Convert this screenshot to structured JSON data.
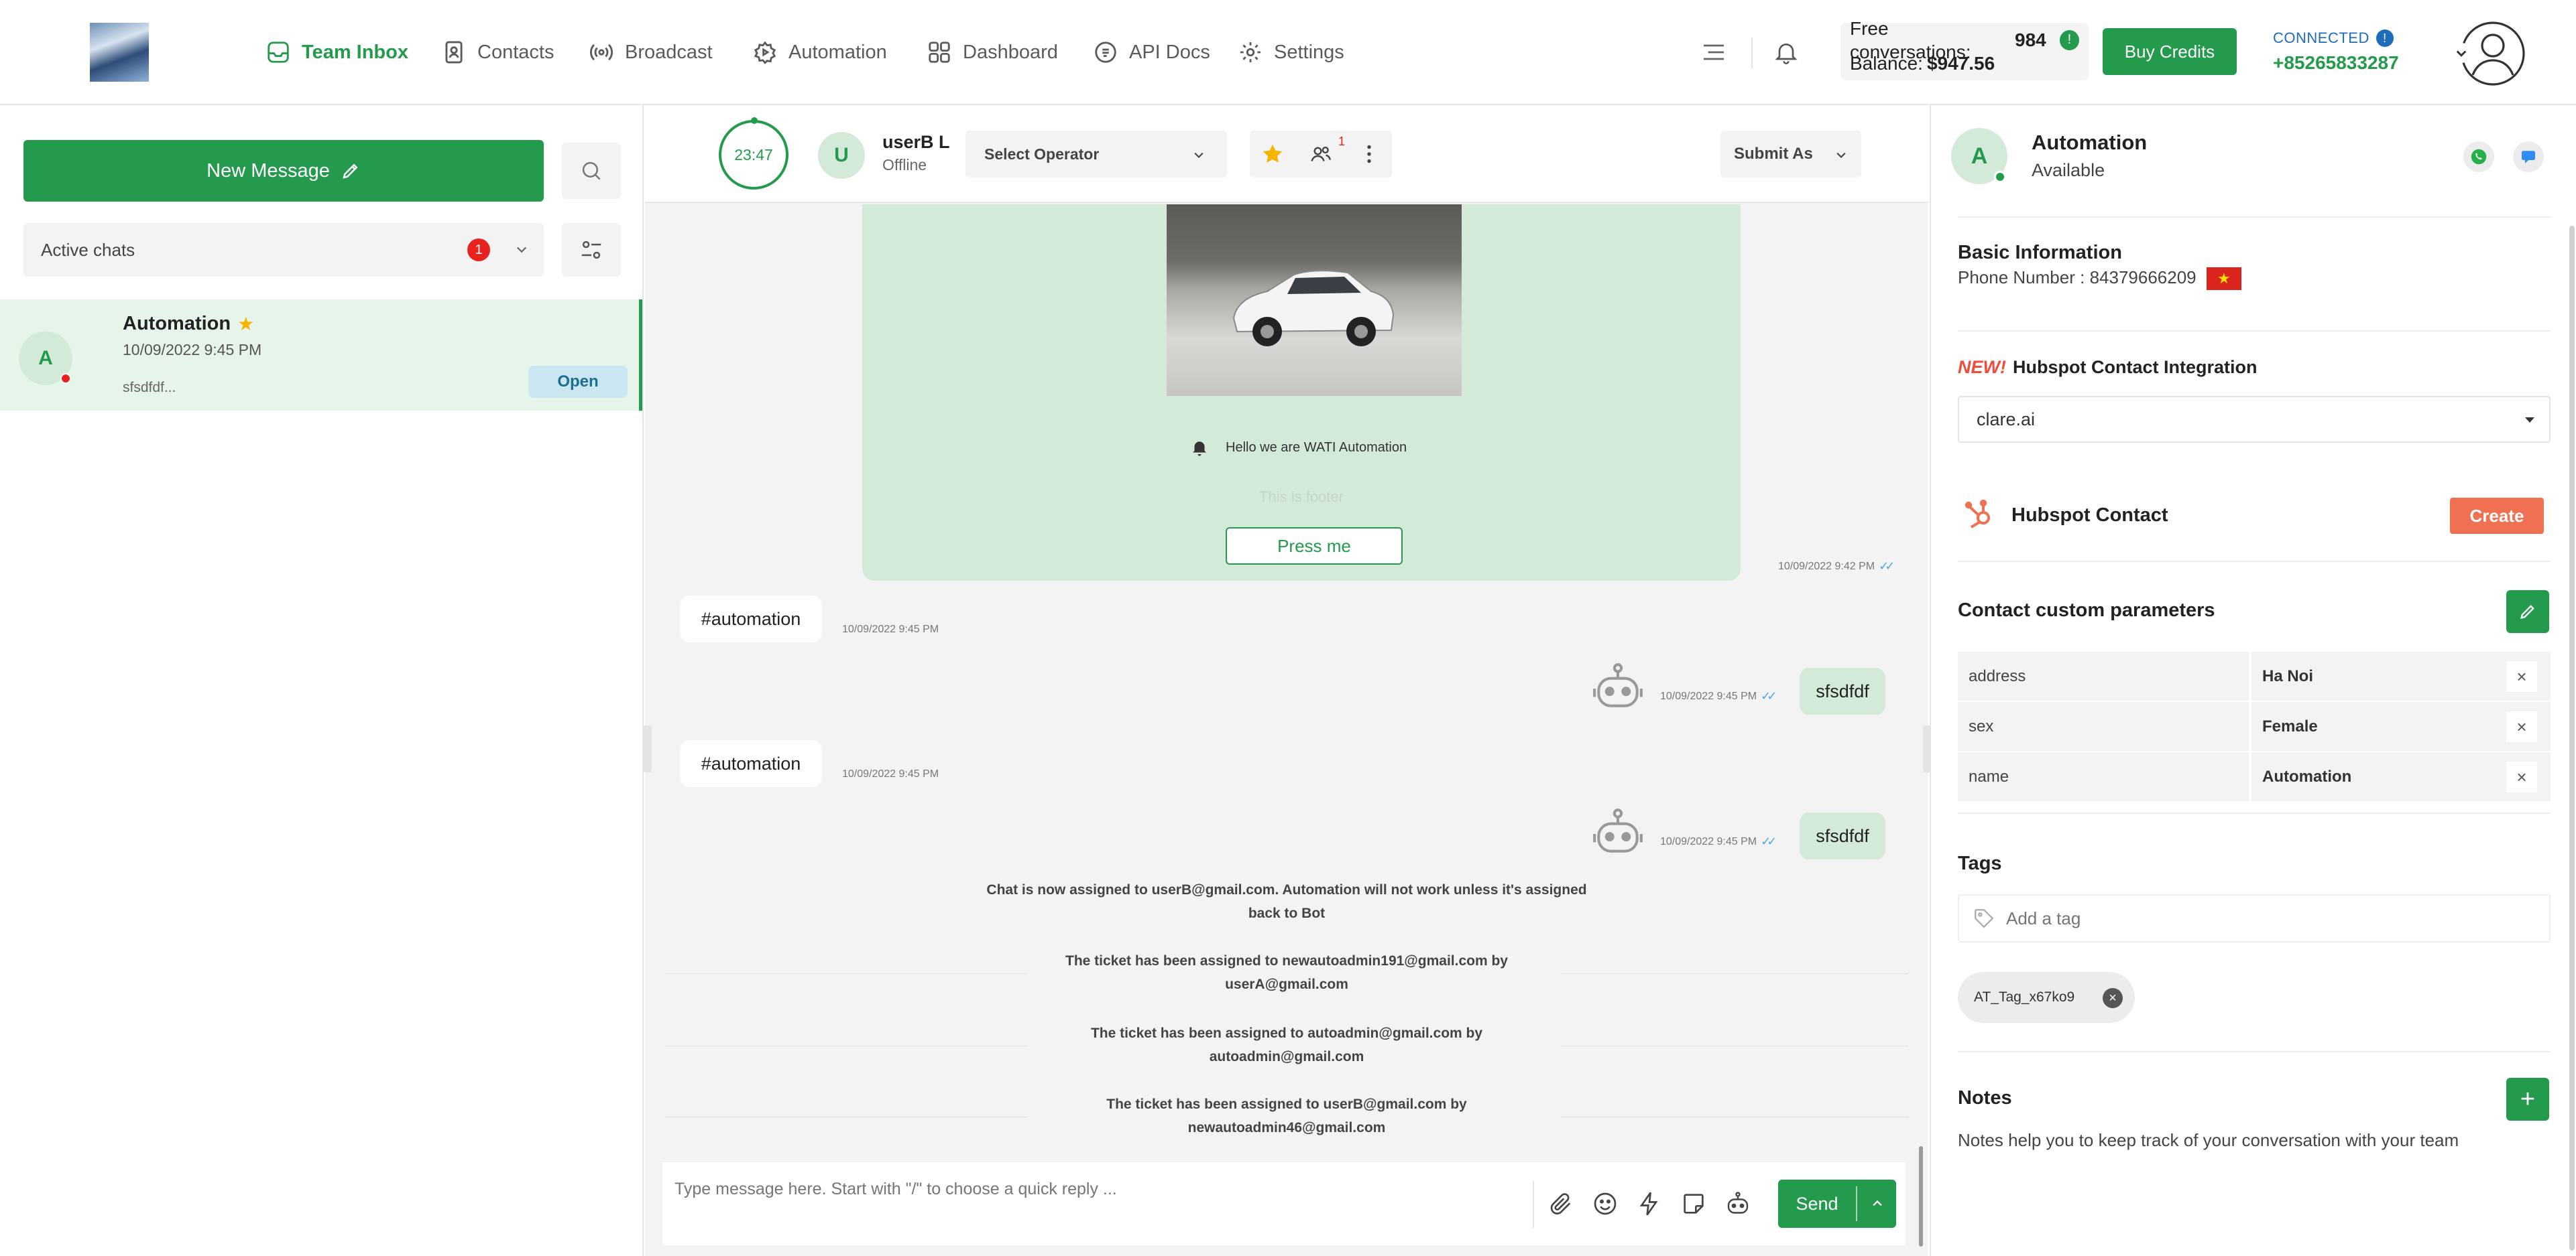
{
  "nav": {
    "items": [
      {
        "label": "Team Inbox",
        "icon": "inbox-icon"
      },
      {
        "label": "Contacts",
        "icon": "contacts-icon"
      },
      {
        "label": "Broadcast",
        "icon": "broadcast-icon"
      },
      {
        "label": "Automation",
        "icon": "automation-icon"
      },
      {
        "label": "Dashboard",
        "icon": "dashboard-icon"
      },
      {
        "label": "API Docs",
        "icon": "api-docs-icon"
      },
      {
        "label": "Settings",
        "icon": "gear-icon"
      }
    ],
    "active": "Team Inbox"
  },
  "credits": {
    "free_label": "Free conversations:",
    "free_value": "984",
    "info_glyph": "!",
    "balance_label": "Balance:",
    "balance_value": "$947.56",
    "buy_label": "Buy Credits"
  },
  "connection": {
    "status": "CONNECTED",
    "info_glyph": "!",
    "phone": "+85265833287"
  },
  "left": {
    "new_message_label": "New Message",
    "filter_label": "Active chats",
    "filter_count": "1",
    "chats": [
      {
        "avatar": "A",
        "name": "Automation",
        "time": "10/09/2022 9:45 PM",
        "preview": "sfsdfdf...",
        "status": "Open"
      }
    ]
  },
  "chat_header": {
    "timer": "23:47",
    "avatar": "U",
    "user_name": "userB L",
    "user_status": "Offline",
    "operator_placeholder": "Select Operator",
    "badge_count": "1",
    "submit_as": "Submit As"
  },
  "messages": {
    "template": {
      "body": "Hello we are WATI Automation",
      "footer": "This is footer",
      "button": "Press me",
      "time": "10/09/2022 9:42 PM"
    },
    "items": [
      {
        "dir": "in",
        "text": "#automation",
        "time": "10/09/2022 9:45 PM"
      },
      {
        "dir": "out",
        "text": "sfsdfdf",
        "time": "10/09/2022 9:45 PM"
      },
      {
        "dir": "in",
        "text": "#automation",
        "time": "10/09/2022 9:45 PM"
      },
      {
        "dir": "out",
        "text": "sfsdfdf",
        "time": "10/09/2022 9:45 PM"
      }
    ],
    "system": [
      {
        "line1": "Chat is now assigned to userB@gmail.com. Automation will not work unless it's assigned",
        "line2": "back to Bot"
      },
      {
        "line1": "The ticket has been assigned to newautoadmin191@gmail.com by",
        "line2": "userA@gmail.com"
      },
      {
        "line1": "The ticket has been assigned to autoadmin@gmail.com by",
        "line2": "autoadmin@gmail.com"
      },
      {
        "line1": "The ticket has been assigned to userB@gmail.com by",
        "line2": "newautoadmin46@gmail.com"
      }
    ]
  },
  "composer": {
    "placeholder": "Type message here. Start with \"/\" to choose a quick reply ...",
    "send_label": "Send"
  },
  "contact": {
    "avatar": "A",
    "name": "Automation",
    "status": "Available",
    "basic_title": "Basic Information",
    "phone_label": "Phone Number :",
    "phone_value": "84379666209",
    "flag_glyph": "★",
    "hubspot_new": "NEW!",
    "hubspot_integration": "Hubspot Contact Integration",
    "hubspot_selected": "clare.ai",
    "hubspot_contact": "Hubspot Contact",
    "create_label": "Create",
    "params_title": "Contact custom parameters",
    "params": [
      {
        "key": "address",
        "value": "Ha Noi"
      },
      {
        "key": "sex",
        "value": "Female"
      },
      {
        "key": "name",
        "value": "Automation"
      }
    ],
    "tags_title": "Tags",
    "tag_placeholder": "Add a tag",
    "tags": [
      "AT_Tag_x67ko9"
    ],
    "notes_title": "Notes",
    "notes_text": "Notes help you to keep track of your conversation with your team"
  },
  "colors": {
    "brand_green": "#239a4c",
    "light_green": "#d4ead9",
    "alert_red": "#e8231f",
    "hubspot_orange": "#f07151",
    "link_blue": "#1e6db8"
  }
}
